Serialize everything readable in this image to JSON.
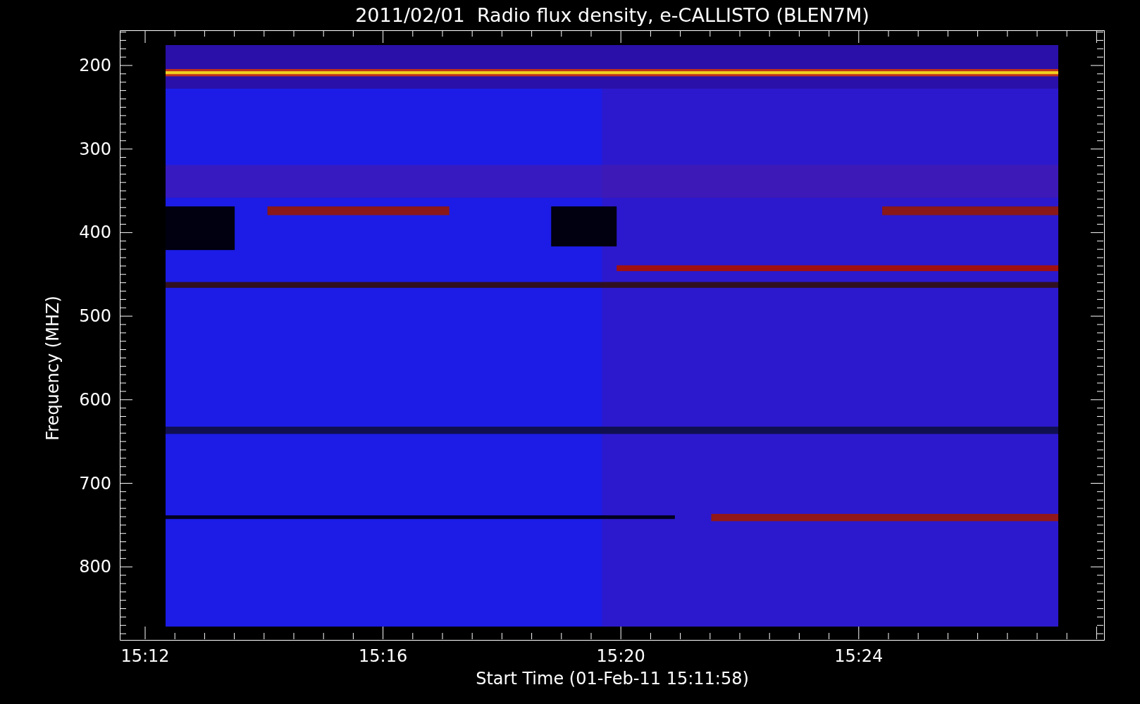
{
  "plot": {
    "title": "2011/02/01  Radio flux density, e-CALLISTO (BLEN7M)",
    "ylabel": "Frequency (MHZ)",
    "xlabel": "Start Time (01-Feb-11 15:11:58)",
    "yticks": [
      "200",
      "300",
      "400",
      "500",
      "600",
      "700",
      "800"
    ],
    "xticks": [
      "15:12",
      "15:16",
      "15:20",
      "15:24"
    ]
  }
}
